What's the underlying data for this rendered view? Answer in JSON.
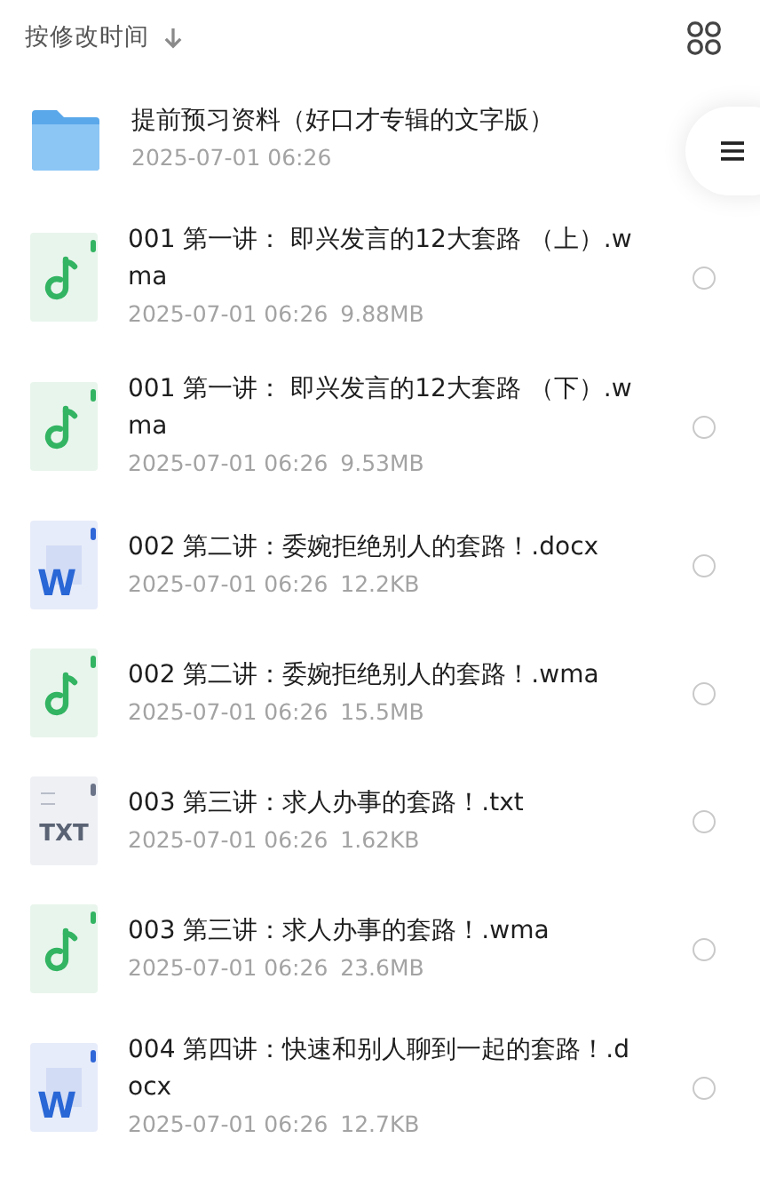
{
  "sort": {
    "label": "按修改时间"
  },
  "files": [
    {
      "kind": "folder",
      "name": "提前预习资料（好口才专辑的文字版）",
      "date": "2025-07-01 06:26"
    },
    {
      "kind": "audio",
      "name": "001 第一讲： 即兴发言的12大套路 （上）.wma",
      "date": "2025-07-01 06:26",
      "size": "9.88MB",
      "selected": false
    },
    {
      "kind": "audio",
      "name": "001 第一讲： 即兴发言的12大套路 （下）.wma",
      "date": "2025-07-01 06:26",
      "size": "9.53MB",
      "selected": false
    },
    {
      "kind": "doc",
      "icon_text": "W",
      "name": "002 第二讲：委婉拒绝别人的套路！.docx",
      "date": "2025-07-01 06:26",
      "size": "12.2KB",
      "selected": false
    },
    {
      "kind": "audio",
      "name": "002 第二讲：委婉拒绝别人的套路！.wma",
      "date": "2025-07-01 06:26",
      "size": "15.5MB",
      "selected": false
    },
    {
      "kind": "txt",
      "icon_text": "TXT",
      "name": "003 第三讲：求人办事的套路！.txt",
      "date": "2025-07-01 06:26",
      "size": "1.62KB",
      "selected": false
    },
    {
      "kind": "audio",
      "name": "003 第三讲：求人办事的套路！.wma",
      "date": "2025-07-01 06:26",
      "size": "23.6MB",
      "selected": false
    },
    {
      "kind": "doc",
      "icon_text": "W",
      "name": "004 第四讲：快速和别人聊到一起的套路！.docx",
      "date": "2025-07-01 06:26",
      "size": "12.7KB",
      "selected": false
    }
  ]
}
